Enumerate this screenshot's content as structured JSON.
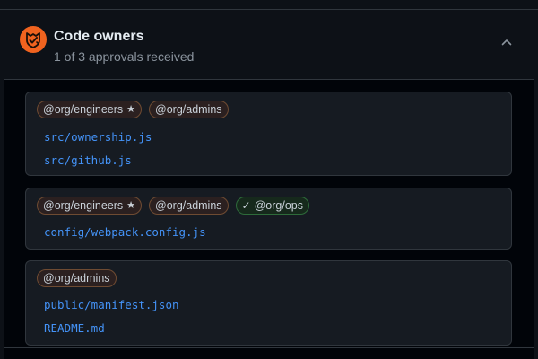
{
  "header": {
    "title": "Code owners",
    "subtitle": "1 of 3 approvals received",
    "logo_icon": "github-org-shield-icon",
    "expand_icon": "chevron-up-icon"
  },
  "colors": {
    "background": "#0d1117",
    "body": "#010409",
    "card": "#161b22",
    "border": "#30363d",
    "logo": "#f0631f",
    "link": "#4493f8",
    "pending_border": "#6f4b32",
    "approved_border": "#2e6b3a"
  },
  "groups": [
    {
      "owners": [
        {
          "label": "@org/engineers",
          "status": "pending",
          "required": true
        },
        {
          "label": "@org/admins",
          "status": "pending",
          "required": false
        }
      ],
      "files": [
        "src/ownership.js",
        "src/github.js"
      ]
    },
    {
      "owners": [
        {
          "label": "@org/engineers",
          "status": "pending",
          "required": true
        },
        {
          "label": "@org/admins",
          "status": "pending",
          "required": false
        },
        {
          "label": "@org/ops",
          "status": "approved",
          "required": false
        }
      ],
      "files": [
        "config/webpack.config.js"
      ]
    },
    {
      "owners": [
        {
          "label": "@org/admins",
          "status": "pending",
          "required": false
        }
      ],
      "files": [
        "public/manifest.json",
        "README.md"
      ]
    }
  ],
  "glyphs": {
    "star": "★",
    "check": "✓"
  }
}
